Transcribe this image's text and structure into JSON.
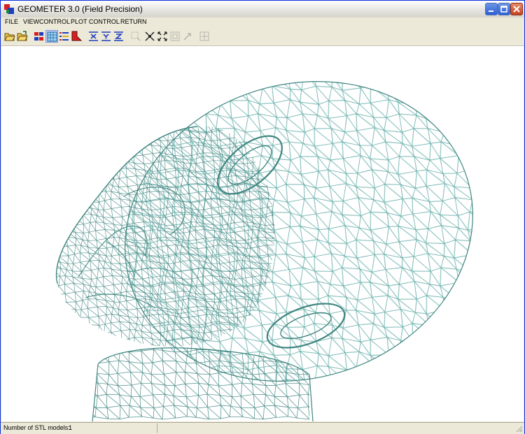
{
  "window": {
    "title": "GEOMETER 3.0 (Field Precision)"
  },
  "menu": {
    "items": [
      "FILE",
      "VIEWCONTROL",
      "PLOT CONTROL",
      "RETURN"
    ]
  },
  "toolbar": {
    "buttons": [
      {
        "icon": "open-folder-icon",
        "enabled": true
      },
      {
        "icon": "open-folder-alt-icon",
        "enabled": true
      },
      {
        "icon": "colored-elements-icon",
        "enabled": true
      },
      {
        "icon": "grid-mesh-icon",
        "enabled": true
      },
      {
        "icon": "list-lines-icon",
        "enabled": true
      },
      {
        "icon": "red-shape-icon",
        "enabled": true
      },
      {
        "icon": "slice-x-icon",
        "enabled": true
      },
      {
        "icon": "slice-y-icon",
        "enabled": true
      },
      {
        "icon": "slice-z-icon",
        "enabled": true
      },
      {
        "icon": "zoom-window-icon",
        "enabled": false
      },
      {
        "icon": "zoom-in-icon",
        "enabled": true
      },
      {
        "icon": "zoom-out-icon",
        "enabled": true
      },
      {
        "icon": "zoom-extent-icon",
        "enabled": false
      },
      {
        "icon": "pan-icon",
        "enabled": false
      },
      {
        "icon": "crosshair-icon",
        "enabled": false
      }
    ]
  },
  "statusbar": {
    "label": "Number of STL models:",
    "value": "1"
  },
  "colors": {
    "mesh": "#3f8580",
    "mesh_light": "#7fc5c0",
    "background": "#ffffff",
    "chrome": "#ece9d8"
  }
}
